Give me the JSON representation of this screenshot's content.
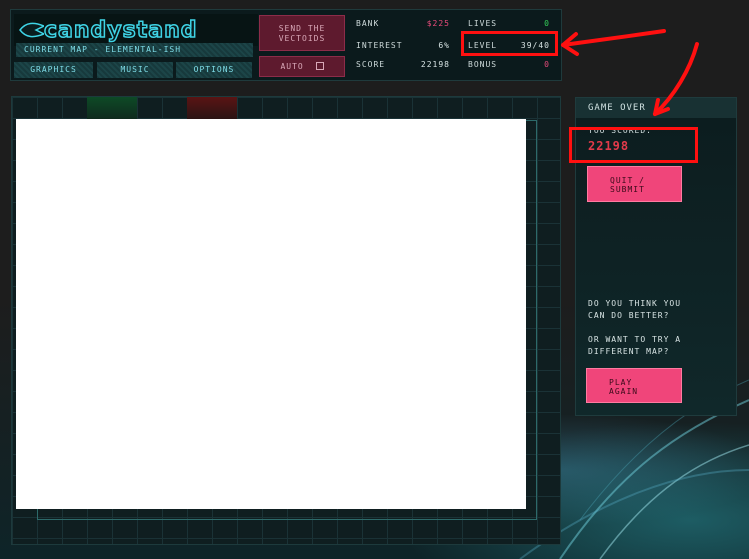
{
  "header": {
    "logo_text": "CANDYSTAND",
    "current_map": "CURRENT MAP - ELEMENTAL-ISH",
    "menu": [
      "GRAPHICS",
      "MUSIC",
      "OPTIONS"
    ],
    "send_button_line1": "SEND THE",
    "send_button_line2": "VECTOIDS",
    "auto_button": "AUTO"
  },
  "stats": {
    "bank_label": "BANK",
    "bank_value": "$225",
    "interest_label": "INTEREST",
    "interest_value": "6%",
    "score_label": "SCORE",
    "score_value": "22198",
    "lives_label": "LIVES",
    "lives_value": "0",
    "level_label": "LEVEL",
    "level_value": "39/40",
    "bonus_label": "BONUS",
    "bonus_value": "0"
  },
  "side_panel": {
    "title": "GAME OVER",
    "scored_label": "YOU SCORED:",
    "scored_value": "22198",
    "quit_line1": "QUIT /",
    "quit_line2": "SUBMIT",
    "prompt1_line1": "DO YOU THINK YOU",
    "prompt1_line2": "CAN DO BETTER?",
    "prompt2_line1": "OR WANT TO TRY A",
    "prompt2_line2": "DIFFERENT MAP?",
    "play_line1": "PLAY",
    "play_line2": "AGAIN"
  },
  "colors": {
    "annotation": "#ff1010",
    "accent_cyan": "#3fd4e6",
    "button_pink": "#f0457a"
  }
}
